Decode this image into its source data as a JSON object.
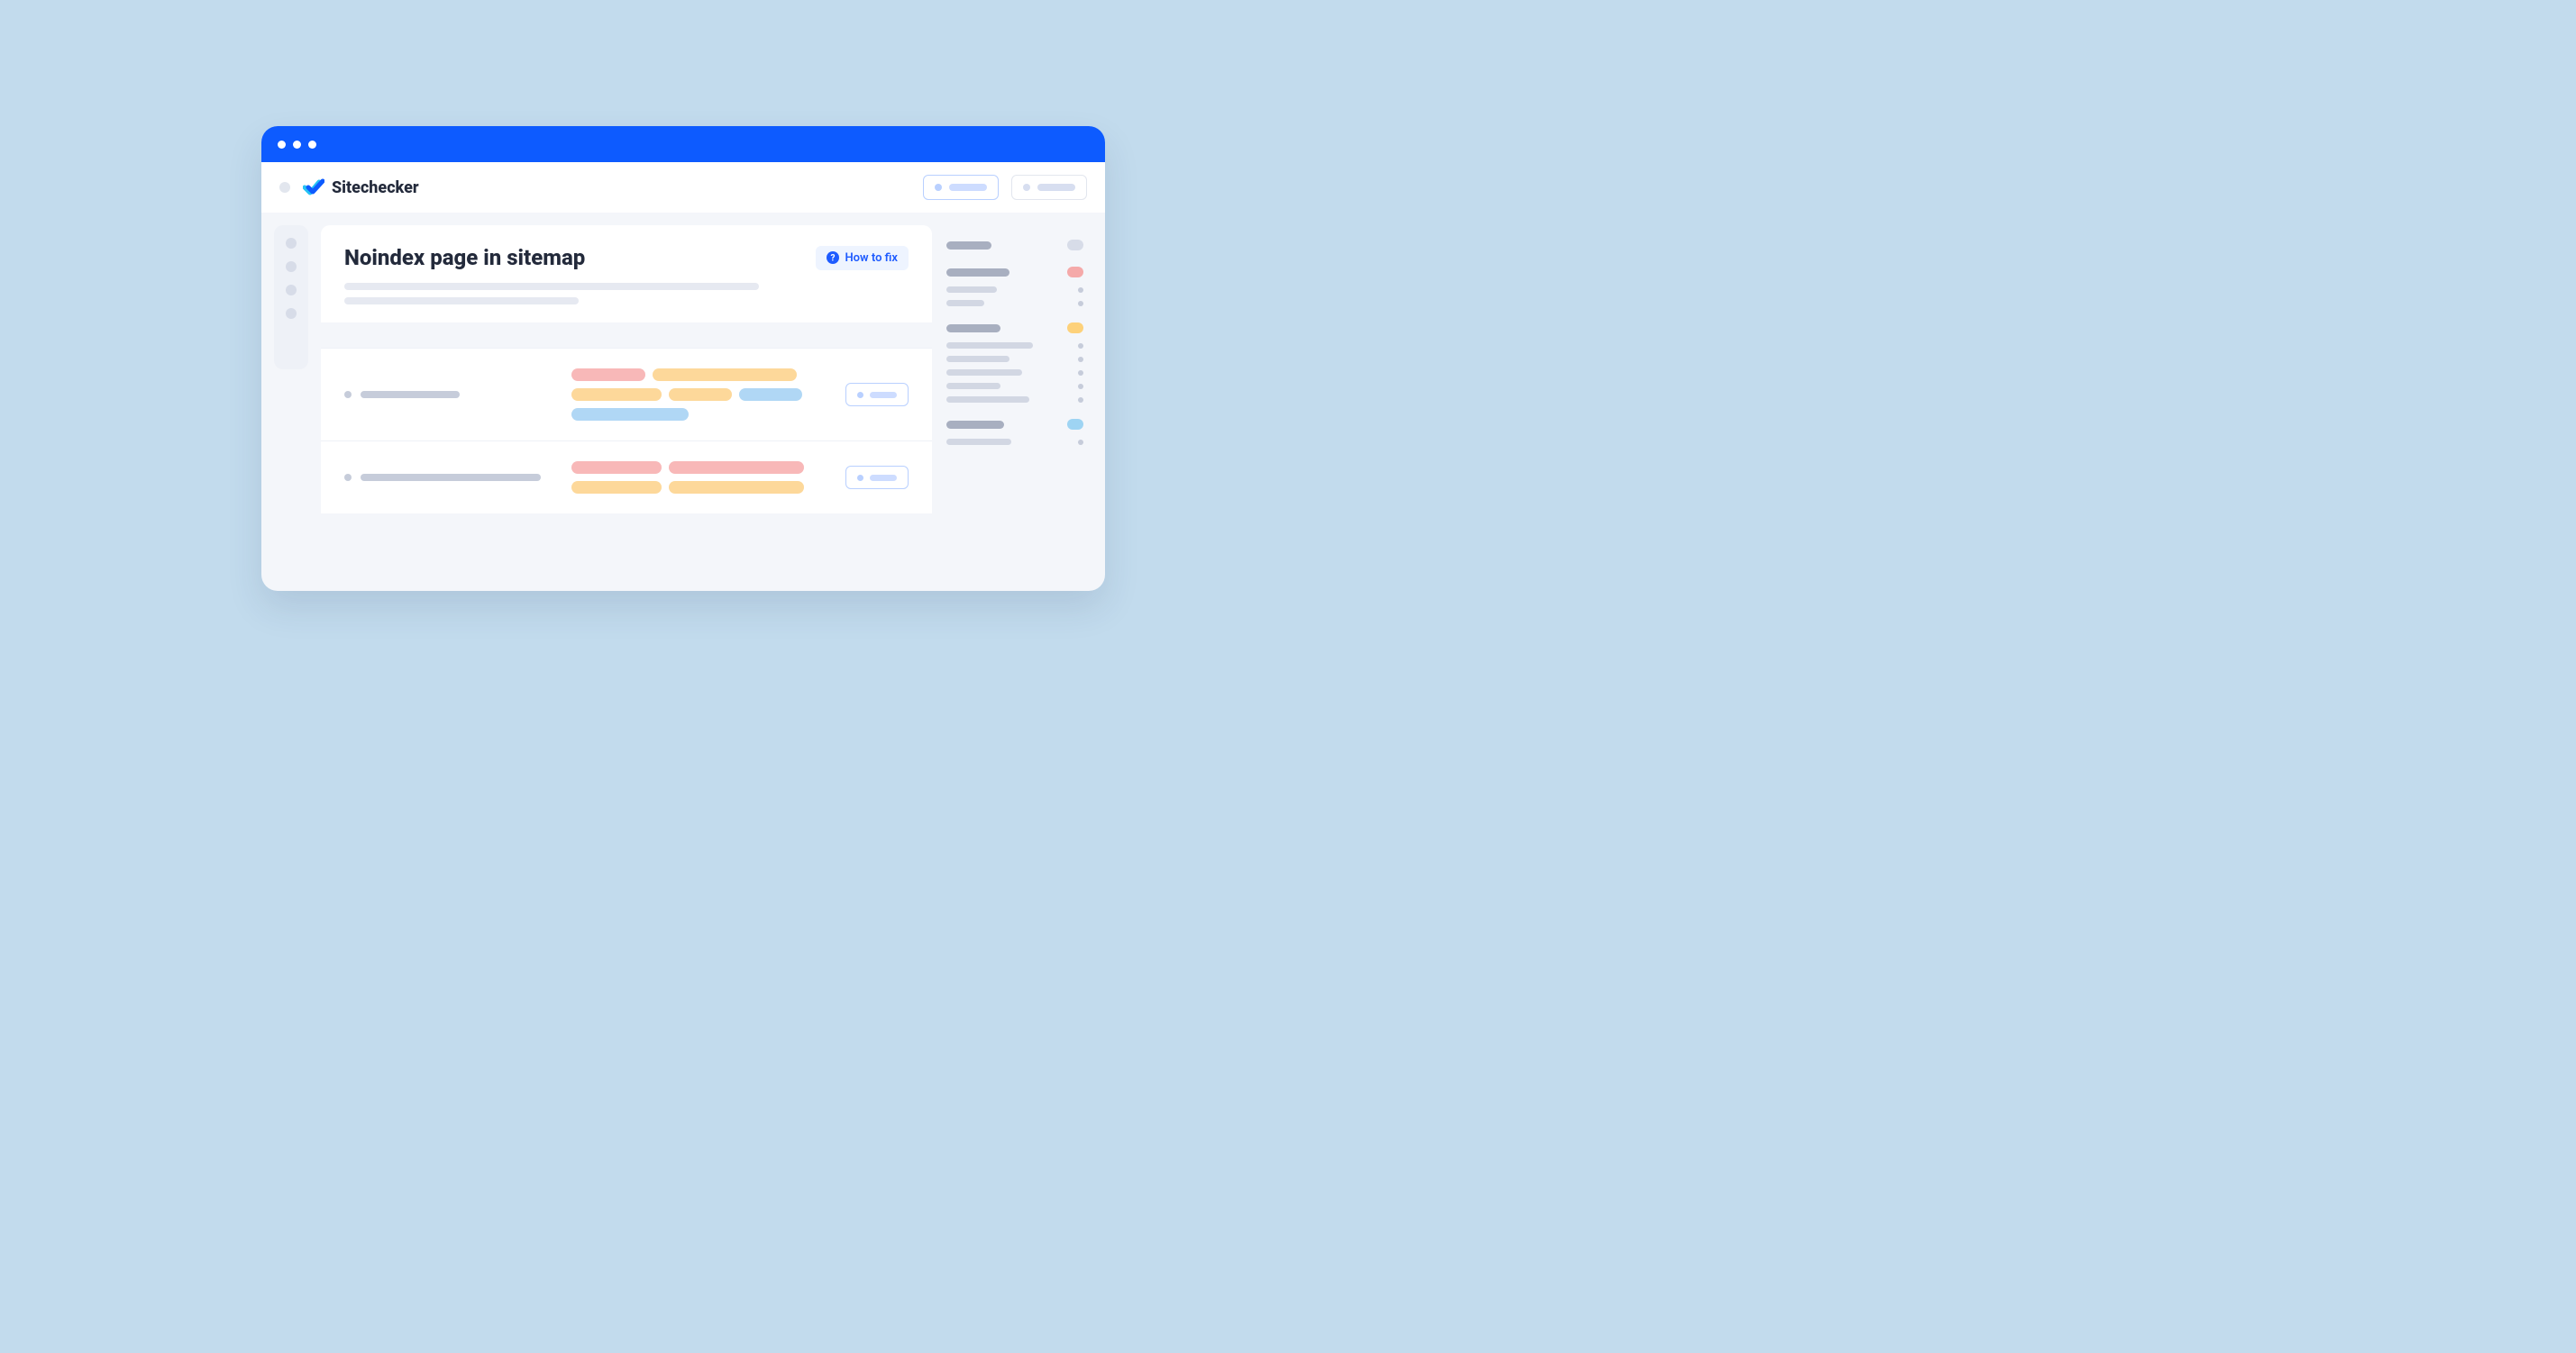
{
  "brand": "Sitechecker",
  "page_title": "Noindex page in sitemap",
  "how_to_fix_label": "How to fix",
  "colors": {
    "accent": "#0d5bff",
    "tag_red": "#f8b8b8",
    "tag_orange": "#fdd89a",
    "tag_blue": "#b0d7f5"
  },
  "right_panel_groups": [
    {
      "badge": "grey",
      "items": 0
    },
    {
      "badge": "red",
      "items": 2
    },
    {
      "badge": "orange",
      "items": 5
    },
    {
      "badge": "blue",
      "items": 1
    }
  ]
}
